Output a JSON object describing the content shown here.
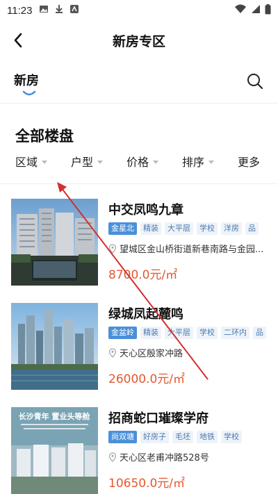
{
  "status_bar": {
    "time": "11:23"
  },
  "header": {
    "title": "新房专区"
  },
  "tabs": {
    "active_label": "新房"
  },
  "section": {
    "title": "全部楼盘"
  },
  "filters": [
    {
      "label": "区域"
    },
    {
      "label": "户型"
    },
    {
      "label": "价格"
    },
    {
      "label": "排序"
    },
    {
      "label": "更多"
    }
  ],
  "listings": [
    {
      "name": "中交凤鸣九章",
      "tags": [
        "金星北",
        "精装",
        "大平层",
        "学校",
        "洋房",
        "品"
      ],
      "address": "望城区金山桥街道新巷南路与金园...",
      "price": "8700.0元/㎡"
    },
    {
      "name": "绿城凤起麓鸣",
      "tags": [
        "金盆岭",
        "精装",
        "大平层",
        "学校",
        "二环内",
        "品"
      ],
      "address": "天心区殷家冲路",
      "price": "26000.0元/㎡"
    },
    {
      "name": "招商蛇口璀璨学府",
      "tags": [
        "尚双塘",
        "好房子",
        "毛坯",
        "地铁",
        "学校"
      ],
      "address": "天心区老甫冲路528号",
      "price": "10650.0元/㎡",
      "image_text": "长沙青年 置业头等舱"
    }
  ],
  "colors": {
    "accent_blue": "#4a90d9",
    "price_orange": "#e4572e",
    "annotation_red": "#d32f2f"
  }
}
